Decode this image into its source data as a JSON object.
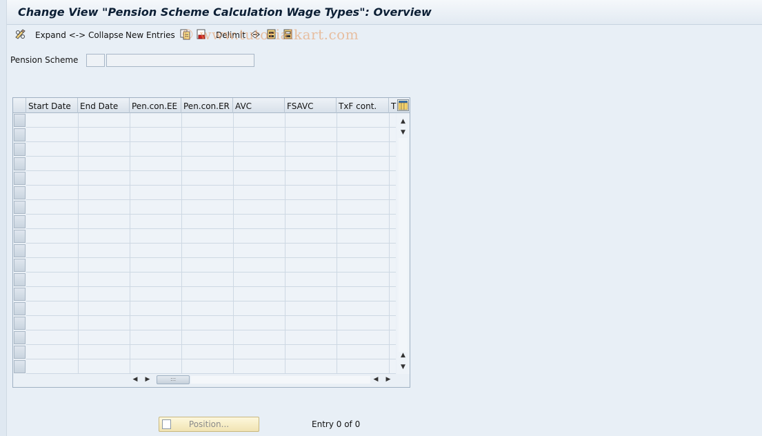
{
  "window": {
    "title": "Change View \"Pension Scheme Calculation Wage Types\": Overview"
  },
  "toolbar": {
    "expand_collapse_label": "Expand <-> Collapse",
    "new_entries_label": "New Entries",
    "delimit_label": "Delimit",
    "watermark": "© www.tutorialkart.com"
  },
  "selection": {
    "pension_scheme_label": "Pension Scheme",
    "pension_scheme_value": "",
    "pension_scheme_text": ""
  },
  "table": {
    "columns": [
      "Start Date",
      "End Date",
      "Pen.con.EE",
      "Pen.con.ER",
      "AVC",
      "FSAVC",
      "TxF cont.",
      "T"
    ],
    "row_count": 18,
    "rows": []
  },
  "footer": {
    "position_button_label": "Position...",
    "entry_text": "Entry 0 of 0"
  },
  "colors": {
    "background": "#e8eff6",
    "title_text": "#0c1f35",
    "position_button": "#f1e4b3"
  }
}
